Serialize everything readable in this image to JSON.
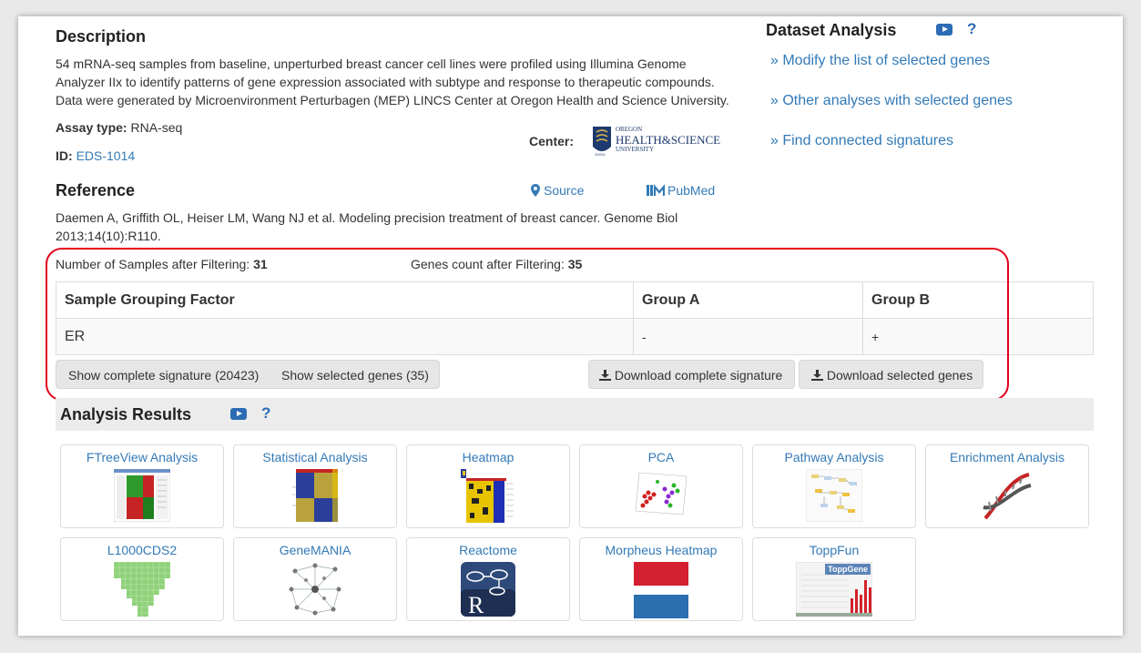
{
  "description": {
    "heading": "Description",
    "text_lines": [
      "54 mRNA-seq samples from baseline, unperturbed breast cancer cell lines were profiled using Illumina Genome",
      "Analyzer IIx to identify patterns of gene expression associated with subtype and response to therapeutic compounds.",
      "Data were generated by Microenvironment Perturbagen (MEP) LINCS Center at Oregon Health and Science University."
    ],
    "assay_label": "Assay type:",
    "assay_value": "RNA-seq",
    "id_label": "ID:",
    "id_value": "EDS-1014",
    "center_label": "Center:",
    "center_logo_text": [
      "OREGON",
      "HEALTH&SCIENCE",
      "UNIVERSITY",
      "OHSU"
    ]
  },
  "reference": {
    "heading": "Reference",
    "source_label": "Source",
    "pubmed_label": "PubMed",
    "citation_lines": [
      "Daemen A, Griffith OL, Heiser LM, Wang NJ et al. Modeling precision treatment of breast cancer. Genome Biol",
      "2013;14(10):R110."
    ]
  },
  "dataset_analysis": {
    "heading": "Dataset Analysis",
    "help": "?",
    "links": [
      "» Modify the list of selected genes",
      "» Other analyses with selected genes",
      "» Find connected signatures"
    ]
  },
  "filtering": {
    "samples_label": "Number of Samples after Filtering:",
    "samples_value": "31",
    "genes_label": "Genes count after Filtering:",
    "genes_value": "35",
    "table": {
      "headers": [
        "Sample Grouping Factor",
        "Group A",
        "Group B"
      ],
      "rows": [
        [
          "ER",
          "-",
          "+"
        ]
      ]
    },
    "buttons": {
      "show_complete": "Show complete signature (20423)",
      "show_selected": "Show selected genes (35)",
      "download_complete": "Download complete signature",
      "download_selected": "Download selected genes"
    }
  },
  "analysis_results": {
    "heading": "Analysis Results",
    "help": "?",
    "tools": [
      {
        "name": "FTreeView Analysis",
        "icon": "ftreeview-thumbnail-icon"
      },
      {
        "name": "Statistical Analysis",
        "icon": "statistical-heatmap-icon"
      },
      {
        "name": "Heatmap",
        "icon": "heatmap-thumbnail-icon"
      },
      {
        "name": "PCA",
        "icon": "pca-scatter-icon"
      },
      {
        "name": "Pathway Analysis",
        "icon": "pathway-diagram-icon"
      },
      {
        "name": "Enrichment Analysis",
        "icon": "dna-helix-icon"
      },
      {
        "name": "L1000CDS2",
        "icon": "l1000cds2-grid-icon"
      },
      {
        "name": "GeneMANIA",
        "icon": "network-graph-icon"
      },
      {
        "name": "Reactome",
        "icon": "reactome-r-icon"
      },
      {
        "name": "Morpheus Heatmap",
        "icon": "morpheus-flag-icon"
      },
      {
        "name": "ToppFun",
        "icon": "toppgene-chart-icon"
      }
    ],
    "toppgene_badge": "ToppGene"
  },
  "colors": {
    "link": "#337ab7",
    "highlight_border": "#e3001b",
    "youtube_blue": "#2c6cb4"
  }
}
